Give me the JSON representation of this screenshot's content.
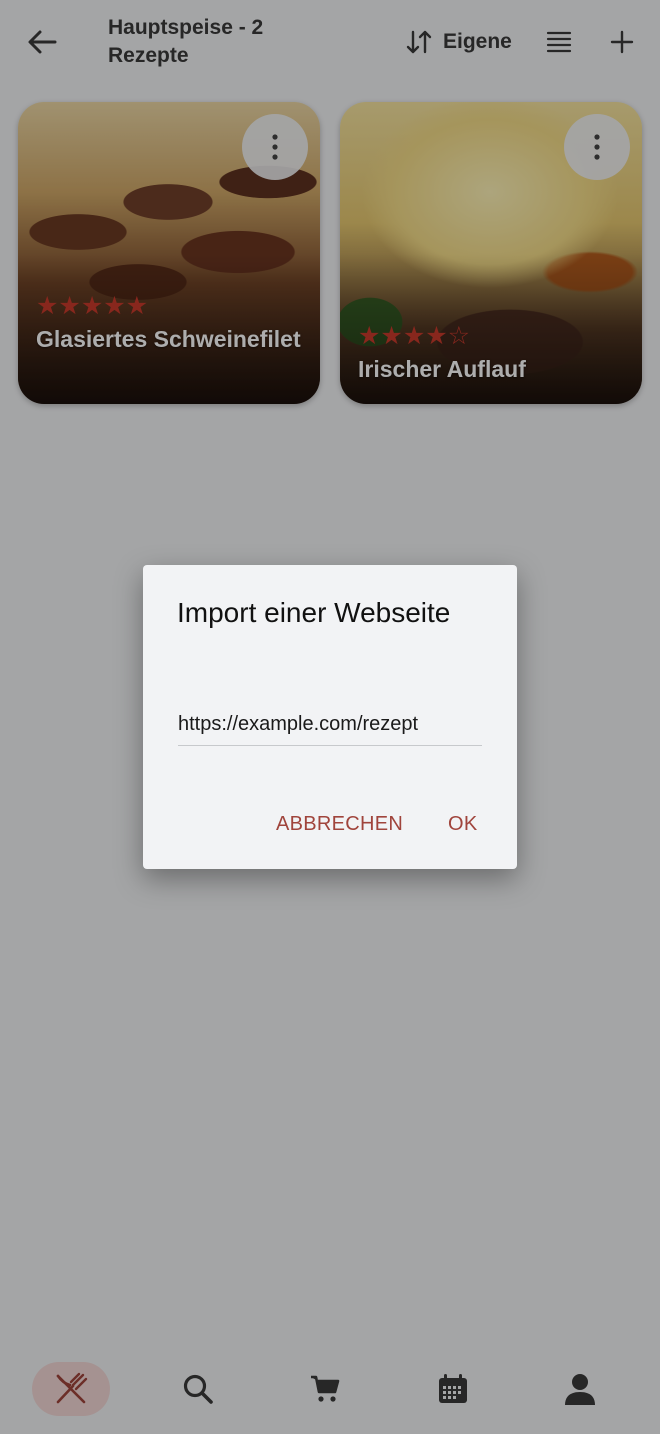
{
  "header": {
    "title": "Hauptspeise - 2 Rezepte",
    "sort_label": "Eigene"
  },
  "recipes": [
    {
      "name": "Glasiertes Schweinefilet",
      "rating": 5,
      "stars_text": "★★★★★"
    },
    {
      "name": "Irischer Auflauf",
      "rating": 4,
      "stars_text": "★★★★☆"
    }
  ],
  "dialog": {
    "title": "Import einer Webseite",
    "url_value": "https://example.com/rezept",
    "cancel_label": "ABBRECHEN",
    "ok_label": "OK"
  },
  "bottom_nav": {
    "items": [
      "recipes-icon",
      "search-icon",
      "cart-icon",
      "calendar-icon",
      "profile-icon"
    ],
    "active": "recipes-icon"
  },
  "colors": {
    "accent": "#a0443c",
    "star": "#c93a2c",
    "active_nav_bg": "#f3d8d6"
  }
}
